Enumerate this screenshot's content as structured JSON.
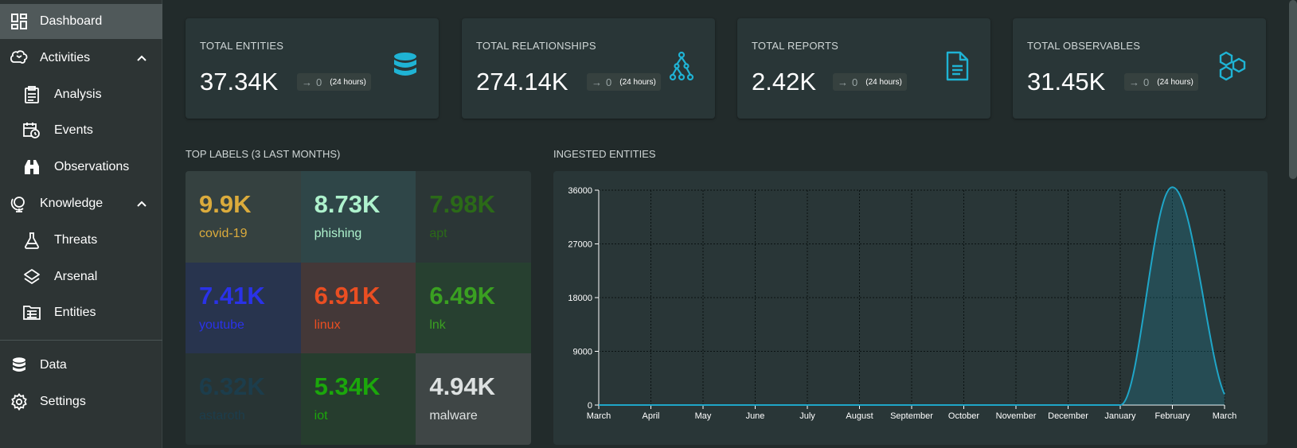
{
  "sidebar": {
    "items": [
      {
        "label": "Dashboard",
        "icon": "dashboard-icon"
      },
      {
        "label": "Activities",
        "icon": "brain-icon"
      },
      {
        "label": "Analysis",
        "icon": "clipboard-icon"
      },
      {
        "label": "Events",
        "icon": "calendar-clock-icon"
      },
      {
        "label": "Observations",
        "icon": "binoculars-icon"
      },
      {
        "label": "Knowledge",
        "icon": "globe-icon"
      },
      {
        "label": "Threats",
        "icon": "flask-icon"
      },
      {
        "label": "Arsenal",
        "icon": "layers-icon"
      },
      {
        "label": "Entities",
        "icon": "folder-table-icon"
      },
      {
        "label": "Data",
        "icon": "database-icon"
      },
      {
        "label": "Settings",
        "icon": "gear-icon"
      }
    ]
  },
  "stats": [
    {
      "title": "TOTAL ENTITIES",
      "value": "37.34K",
      "delta": "0",
      "period": "(24 hours)",
      "icon": "database-icon"
    },
    {
      "title": "TOTAL RELATIONSHIPS",
      "value": "274.14K",
      "delta": "0",
      "period": "(24 hours)",
      "icon": "graph-icon"
    },
    {
      "title": "TOTAL REPORTS",
      "value": "2.42K",
      "delta": "0",
      "period": "(24 hours)",
      "icon": "document-icon"
    },
    {
      "title": "TOTAL OBSERVABLES",
      "value": "31.45K",
      "delta": "0",
      "period": "(24 hours)",
      "icon": "hexagons-icon"
    }
  ],
  "top_labels": {
    "title": "TOP LABELS (3 LAST MONTHS)",
    "items": [
      {
        "value": "9.9K",
        "name": "covid-19",
        "color": "#dbab3c",
        "bg": "#354140"
      },
      {
        "value": "8.73K",
        "name": "phishing",
        "color": "#aef2cd",
        "bg": "#2f4648"
      },
      {
        "value": "7.98K",
        "name": "apt",
        "color": "#2b6a18",
        "bg": "#2b3636"
      },
      {
        "value": "7.41K",
        "name": "youtube",
        "color": "#2a32e8",
        "bg": "#28344e"
      },
      {
        "value": "6.91K",
        "name": "linux",
        "color": "#ea4e22",
        "bg": "#443838"
      },
      {
        "value": "6.49K",
        "name": "lnk",
        "color": "#3aa021",
        "bg": "#274030"
      },
      {
        "value": "6.32K",
        "name": "astaroth",
        "color": "#1c3d4c",
        "bg": "#283434"
      },
      {
        "value": "5.34K",
        "name": "iot",
        "color": "#1ba70b",
        "bg": "#263d2e"
      },
      {
        "value": "4.94K",
        "name": "malware",
        "color": "#dde1e1",
        "bg": "#3f4646"
      }
    ]
  },
  "ingested": {
    "title": "INGESTED ENTITIES"
  },
  "chart_data": {
    "type": "area",
    "categories": [
      "March",
      "April",
      "May",
      "June",
      "July",
      "August",
      "September",
      "October",
      "November",
      "December",
      "January",
      "February",
      "March"
    ],
    "values": [
      0,
      0,
      0,
      0,
      0,
      0,
      0,
      0,
      0,
      0,
      0,
      36500,
      1800
    ],
    "yticks": [
      "36000",
      "27000",
      "18000",
      "9000",
      "0"
    ],
    "ylim": [
      0,
      36000
    ],
    "grid": true,
    "line_color": "#1fa6c8"
  }
}
